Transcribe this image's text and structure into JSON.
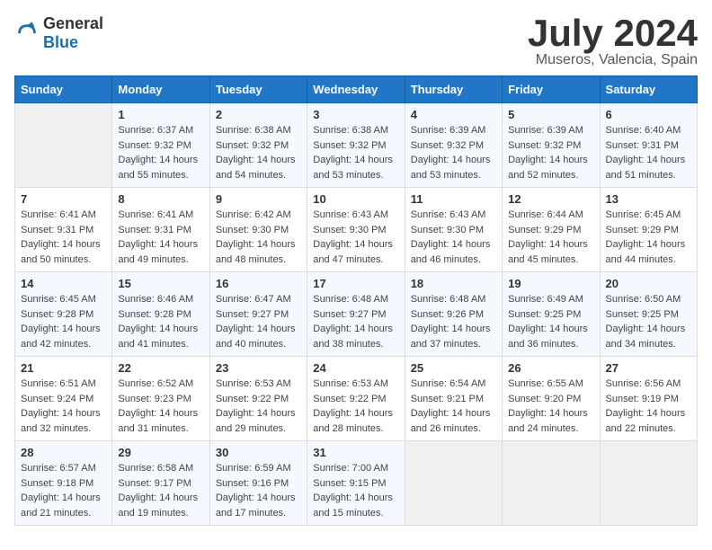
{
  "header": {
    "logo_general": "General",
    "logo_blue": "Blue",
    "month_year": "July 2024",
    "location": "Museros, Valencia, Spain"
  },
  "calendar": {
    "days_of_week": [
      "Sunday",
      "Monday",
      "Tuesday",
      "Wednesday",
      "Thursday",
      "Friday",
      "Saturday"
    ],
    "weeks": [
      [
        {
          "num": "",
          "sunrise": "",
          "sunset": "",
          "daylight": ""
        },
        {
          "num": "1",
          "sunrise": "Sunrise: 6:37 AM",
          "sunset": "Sunset: 9:32 PM",
          "daylight": "Daylight: 14 hours and 55 minutes."
        },
        {
          "num": "2",
          "sunrise": "Sunrise: 6:38 AM",
          "sunset": "Sunset: 9:32 PM",
          "daylight": "Daylight: 14 hours and 54 minutes."
        },
        {
          "num": "3",
          "sunrise": "Sunrise: 6:38 AM",
          "sunset": "Sunset: 9:32 PM",
          "daylight": "Daylight: 14 hours and 53 minutes."
        },
        {
          "num": "4",
          "sunrise": "Sunrise: 6:39 AM",
          "sunset": "Sunset: 9:32 PM",
          "daylight": "Daylight: 14 hours and 53 minutes."
        },
        {
          "num": "5",
          "sunrise": "Sunrise: 6:39 AM",
          "sunset": "Sunset: 9:32 PM",
          "daylight": "Daylight: 14 hours and 52 minutes."
        },
        {
          "num": "6",
          "sunrise": "Sunrise: 6:40 AM",
          "sunset": "Sunset: 9:31 PM",
          "daylight": "Daylight: 14 hours and 51 minutes."
        }
      ],
      [
        {
          "num": "7",
          "sunrise": "Sunrise: 6:41 AM",
          "sunset": "Sunset: 9:31 PM",
          "daylight": "Daylight: 14 hours and 50 minutes."
        },
        {
          "num": "8",
          "sunrise": "Sunrise: 6:41 AM",
          "sunset": "Sunset: 9:31 PM",
          "daylight": "Daylight: 14 hours and 49 minutes."
        },
        {
          "num": "9",
          "sunrise": "Sunrise: 6:42 AM",
          "sunset": "Sunset: 9:30 PM",
          "daylight": "Daylight: 14 hours and 48 minutes."
        },
        {
          "num": "10",
          "sunrise": "Sunrise: 6:43 AM",
          "sunset": "Sunset: 9:30 PM",
          "daylight": "Daylight: 14 hours and 47 minutes."
        },
        {
          "num": "11",
          "sunrise": "Sunrise: 6:43 AM",
          "sunset": "Sunset: 9:30 PM",
          "daylight": "Daylight: 14 hours and 46 minutes."
        },
        {
          "num": "12",
          "sunrise": "Sunrise: 6:44 AM",
          "sunset": "Sunset: 9:29 PM",
          "daylight": "Daylight: 14 hours and 45 minutes."
        },
        {
          "num": "13",
          "sunrise": "Sunrise: 6:45 AM",
          "sunset": "Sunset: 9:29 PM",
          "daylight": "Daylight: 14 hours and 44 minutes."
        }
      ],
      [
        {
          "num": "14",
          "sunrise": "Sunrise: 6:45 AM",
          "sunset": "Sunset: 9:28 PM",
          "daylight": "Daylight: 14 hours and 42 minutes."
        },
        {
          "num": "15",
          "sunrise": "Sunrise: 6:46 AM",
          "sunset": "Sunset: 9:28 PM",
          "daylight": "Daylight: 14 hours and 41 minutes."
        },
        {
          "num": "16",
          "sunrise": "Sunrise: 6:47 AM",
          "sunset": "Sunset: 9:27 PM",
          "daylight": "Daylight: 14 hours and 40 minutes."
        },
        {
          "num": "17",
          "sunrise": "Sunrise: 6:48 AM",
          "sunset": "Sunset: 9:27 PM",
          "daylight": "Daylight: 14 hours and 38 minutes."
        },
        {
          "num": "18",
          "sunrise": "Sunrise: 6:48 AM",
          "sunset": "Sunset: 9:26 PM",
          "daylight": "Daylight: 14 hours and 37 minutes."
        },
        {
          "num": "19",
          "sunrise": "Sunrise: 6:49 AM",
          "sunset": "Sunset: 9:25 PM",
          "daylight": "Daylight: 14 hours and 36 minutes."
        },
        {
          "num": "20",
          "sunrise": "Sunrise: 6:50 AM",
          "sunset": "Sunset: 9:25 PM",
          "daylight": "Daylight: 14 hours and 34 minutes."
        }
      ],
      [
        {
          "num": "21",
          "sunrise": "Sunrise: 6:51 AM",
          "sunset": "Sunset: 9:24 PM",
          "daylight": "Daylight: 14 hours and 32 minutes."
        },
        {
          "num": "22",
          "sunrise": "Sunrise: 6:52 AM",
          "sunset": "Sunset: 9:23 PM",
          "daylight": "Daylight: 14 hours and 31 minutes."
        },
        {
          "num": "23",
          "sunrise": "Sunrise: 6:53 AM",
          "sunset": "Sunset: 9:22 PM",
          "daylight": "Daylight: 14 hours and 29 minutes."
        },
        {
          "num": "24",
          "sunrise": "Sunrise: 6:53 AM",
          "sunset": "Sunset: 9:22 PM",
          "daylight": "Daylight: 14 hours and 28 minutes."
        },
        {
          "num": "25",
          "sunrise": "Sunrise: 6:54 AM",
          "sunset": "Sunset: 9:21 PM",
          "daylight": "Daylight: 14 hours and 26 minutes."
        },
        {
          "num": "26",
          "sunrise": "Sunrise: 6:55 AM",
          "sunset": "Sunset: 9:20 PM",
          "daylight": "Daylight: 14 hours and 24 minutes."
        },
        {
          "num": "27",
          "sunrise": "Sunrise: 6:56 AM",
          "sunset": "Sunset: 9:19 PM",
          "daylight": "Daylight: 14 hours and 22 minutes."
        }
      ],
      [
        {
          "num": "28",
          "sunrise": "Sunrise: 6:57 AM",
          "sunset": "Sunset: 9:18 PM",
          "daylight": "Daylight: 14 hours and 21 minutes."
        },
        {
          "num": "29",
          "sunrise": "Sunrise: 6:58 AM",
          "sunset": "Sunset: 9:17 PM",
          "daylight": "Daylight: 14 hours and 19 minutes."
        },
        {
          "num": "30",
          "sunrise": "Sunrise: 6:59 AM",
          "sunset": "Sunset: 9:16 PM",
          "daylight": "Daylight: 14 hours and 17 minutes."
        },
        {
          "num": "31",
          "sunrise": "Sunrise: 7:00 AM",
          "sunset": "Sunset: 9:15 PM",
          "daylight": "Daylight: 14 hours and 15 minutes."
        },
        {
          "num": "",
          "sunrise": "",
          "sunset": "",
          "daylight": ""
        },
        {
          "num": "",
          "sunrise": "",
          "sunset": "",
          "daylight": ""
        },
        {
          "num": "",
          "sunrise": "",
          "sunset": "",
          "daylight": ""
        }
      ]
    ]
  }
}
